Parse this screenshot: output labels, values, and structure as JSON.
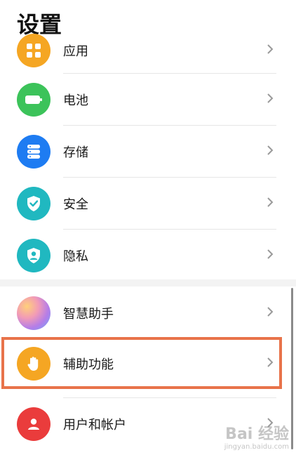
{
  "page_title": "设置",
  "items": [
    {
      "label": "应用",
      "icon": "apps-icon",
      "color": "#f5a623"
    },
    {
      "label": "电池",
      "icon": "battery-icon",
      "color": "#3cc35a"
    },
    {
      "label": "存储",
      "icon": "storage-icon",
      "color": "#1e7cf2"
    },
    {
      "label": "安全",
      "icon": "shield-check-icon",
      "color": "#20b8c0"
    },
    {
      "label": "隐私",
      "icon": "privacy-icon",
      "color": "#20b8c0"
    },
    {
      "label": "智慧助手",
      "icon": "assistant-icon",
      "color": "#b47de8"
    },
    {
      "label": "辅助功能",
      "icon": "hand-icon",
      "color": "#f5a623"
    },
    {
      "label": "用户和帐户",
      "icon": "user-icon",
      "color": "#ea3c3c"
    }
  ],
  "highlight_color": "#e8734a",
  "watermark": {
    "line1": "Bai 经验",
    "line2": "jingyan.baidu.com"
  }
}
